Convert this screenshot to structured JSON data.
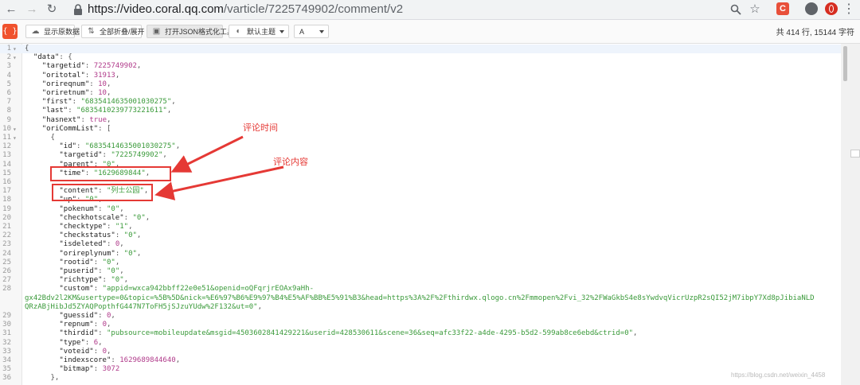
{
  "browser": {
    "url_host": "https://video.coral.qq.com",
    "url_path": "/varticle/7225749902/comment/v2",
    "ext_badge": "C"
  },
  "toolbar": {
    "logo": "{ }",
    "buttons": [
      {
        "label": "显示原数据"
      },
      {
        "label": "全部折叠/展开"
      },
      {
        "label": "打开JSON格式化工具"
      },
      {
        "label": "默认主题"
      },
      {
        "label": "A"
      }
    ],
    "stats": "共 414 行,  15144 字符"
  },
  "code_lines": [
    {
      "n": "1",
      "f": "▾",
      "t": [
        [
          "p",
          "{"
        ]
      ]
    },
    {
      "n": "2",
      "f": "▾",
      "t": [
        [
          "p",
          "  "
        ],
        [
          "k",
          "\"data\""
        ],
        [
          "p",
          ": {"
        ]
      ]
    },
    {
      "n": "3",
      "f": "",
      "t": [
        [
          "p",
          "    "
        ],
        [
          "k",
          "\"targetid\""
        ],
        [
          "p",
          ": "
        ],
        [
          "n",
          "7225749902"
        ],
        [
          "p",
          ","
        ]
      ]
    },
    {
      "n": "4",
      "f": "",
      "t": [
        [
          "p",
          "    "
        ],
        [
          "k",
          "\"oritotal\""
        ],
        [
          "p",
          ": "
        ],
        [
          "n",
          "31913"
        ],
        [
          "p",
          ","
        ]
      ]
    },
    {
      "n": "5",
      "f": "",
      "t": [
        [
          "p",
          "    "
        ],
        [
          "k",
          "\"orireqnum\""
        ],
        [
          "p",
          ": "
        ],
        [
          "n",
          "10"
        ],
        [
          "p",
          ","
        ]
      ]
    },
    {
      "n": "6",
      "f": "",
      "t": [
        [
          "p",
          "    "
        ],
        [
          "k",
          "\"oriretnum\""
        ],
        [
          "p",
          ": "
        ],
        [
          "n",
          "10"
        ],
        [
          "p",
          ","
        ]
      ]
    },
    {
      "n": "7",
      "f": "",
      "t": [
        [
          "p",
          "    "
        ],
        [
          "k",
          "\"first\""
        ],
        [
          "p",
          ": "
        ],
        [
          "s",
          "\"6835414635001030275\""
        ],
        [
          "p",
          ","
        ]
      ]
    },
    {
      "n": "8",
      "f": "",
      "t": [
        [
          "p",
          "    "
        ],
        [
          "k",
          "\"last\""
        ],
        [
          "p",
          ": "
        ],
        [
          "s",
          "\"6835410239773221611\""
        ],
        [
          "p",
          ","
        ]
      ]
    },
    {
      "n": "9",
      "f": "",
      "t": [
        [
          "p",
          "    "
        ],
        [
          "k",
          "\"hasnext\""
        ],
        [
          "p",
          ": "
        ],
        [
          "n",
          "true"
        ],
        [
          "p",
          ","
        ]
      ]
    },
    {
      "n": "10",
      "f": "▾",
      "t": [
        [
          "p",
          "    "
        ],
        [
          "k",
          "\"oriCommList\""
        ],
        [
          "p",
          ": ["
        ]
      ]
    },
    {
      "n": "11",
      "f": "▾",
      "t": [
        [
          "p",
          "      {"
        ]
      ]
    },
    {
      "n": "12",
      "f": "",
      "t": [
        [
          "p",
          "        "
        ],
        [
          "k",
          "\"id\""
        ],
        [
          "p",
          ": "
        ],
        [
          "s",
          "\"6835414635001030275\""
        ],
        [
          "p",
          ","
        ]
      ]
    },
    {
      "n": "13",
      "f": "",
      "t": [
        [
          "p",
          "        "
        ],
        [
          "k",
          "\"targetid\""
        ],
        [
          "p",
          ": "
        ],
        [
          "s",
          "\"7225749902\""
        ],
        [
          "p",
          ","
        ]
      ]
    },
    {
      "n": "14",
      "f": "",
      "t": [
        [
          "p",
          "        "
        ],
        [
          "k",
          "\"parent\""
        ],
        [
          "p",
          ": "
        ],
        [
          "s",
          "\"0\""
        ],
        [
          "p",
          ","
        ]
      ]
    },
    {
      "n": "15",
      "f": "",
      "t": [
        [
          "p",
          "        "
        ],
        [
          "k",
          "\"time\""
        ],
        [
          "p",
          ": "
        ],
        [
          "s",
          "\"1629689844\""
        ],
        [
          "p",
          ","
        ]
      ]
    },
    {
      "n": "16",
      "f": "",
      "t": [
        [
          "p",
          " "
        ]
      ]
    },
    {
      "n": "17",
      "f": "",
      "t": [
        [
          "p",
          "        "
        ],
        [
          "k",
          "\"content\""
        ],
        [
          "p",
          ": "
        ],
        [
          "s",
          "\"列士公园\""
        ],
        [
          "p",
          ","
        ]
      ]
    },
    {
      "n": "18",
      "f": "",
      "t": [
        [
          "p",
          "        "
        ],
        [
          "k",
          "\"up\""
        ],
        [
          "p",
          ": "
        ],
        [
          "s",
          "\"0\""
        ],
        [
          "p",
          ","
        ]
      ]
    },
    {
      "n": "19",
      "f": "",
      "t": [
        [
          "p",
          "        "
        ],
        [
          "k",
          "\"pokenum\""
        ],
        [
          "p",
          ": "
        ],
        [
          "s",
          "\"0\""
        ],
        [
          "p",
          ","
        ]
      ]
    },
    {
      "n": "20",
      "f": "",
      "t": [
        [
          "p",
          "        "
        ],
        [
          "k",
          "\"checkhotscale\""
        ],
        [
          "p",
          ": "
        ],
        [
          "s",
          "\"0\""
        ],
        [
          "p",
          ","
        ]
      ]
    },
    {
      "n": "21",
      "f": "",
      "t": [
        [
          "p",
          "        "
        ],
        [
          "k",
          "\"checktype\""
        ],
        [
          "p",
          ": "
        ],
        [
          "s",
          "\"1\""
        ],
        [
          "p",
          ","
        ]
      ]
    },
    {
      "n": "22",
      "f": "",
      "t": [
        [
          "p",
          "        "
        ],
        [
          "k",
          "\"checkstatus\""
        ],
        [
          "p",
          ": "
        ],
        [
          "s",
          "\"0\""
        ],
        [
          "p",
          ","
        ]
      ]
    },
    {
      "n": "23",
      "f": "",
      "t": [
        [
          "p",
          "        "
        ],
        [
          "k",
          "\"isdeleted\""
        ],
        [
          "p",
          ": "
        ],
        [
          "n",
          "0"
        ],
        [
          "p",
          ","
        ]
      ]
    },
    {
      "n": "24",
      "f": "",
      "t": [
        [
          "p",
          "        "
        ],
        [
          "k",
          "\"orireplynum\""
        ],
        [
          "p",
          ": "
        ],
        [
          "s",
          "\"0\""
        ],
        [
          "p",
          ","
        ]
      ]
    },
    {
      "n": "25",
      "f": "",
      "t": [
        [
          "p",
          "        "
        ],
        [
          "k",
          "\"rootid\""
        ],
        [
          "p",
          ": "
        ],
        [
          "s",
          "\"0\""
        ],
        [
          "p",
          ","
        ]
      ]
    },
    {
      "n": "26",
      "f": "",
      "t": [
        [
          "p",
          "        "
        ],
        [
          "k",
          "\"puserid\""
        ],
        [
          "p",
          ": "
        ],
        [
          "s",
          "\"0\""
        ],
        [
          "p",
          ","
        ]
      ]
    },
    {
      "n": "27",
      "f": "",
      "t": [
        [
          "p",
          "        "
        ],
        [
          "k",
          "\"richtype\""
        ],
        [
          "p",
          ": "
        ],
        [
          "s",
          "\"0\""
        ],
        [
          "p",
          ","
        ]
      ]
    },
    {
      "n": "28",
      "f": "",
      "t": [
        [
          "p",
          "        "
        ],
        [
          "k",
          "\"custom\""
        ],
        [
          "p",
          ": "
        ],
        [
          "s",
          "\"appid=wxca942bbff22e0e51&openid=oQFqrjrEOAx9aHh-"
        ]
      ]
    },
    {
      "n": "",
      "f": "",
      "t": [
        [
          "s",
          "gx42Bdv2l2KM&usertype=0&topic=%5B%5D&nick=%E6%97%B6%E9%97%B4%E5%AF%BB%E5%91%B3&head=https%3A%2F%2Fthirdwx.qlogo.cn%2Fmmopen%2Fvi_32%2FWaGkbS4e8sYwdvqVicrUzpR2sQI52jM7ibpY7Xd8pJibiaNLD"
        ]
      ]
    },
    {
      "n": "",
      "f": "",
      "t": [
        [
          "s",
          "QRzABjHibJd5ZYAQPopthfG447N7ToFH5jSJzuYUdw%2F132&ut=0\""
        ],
        [
          "p",
          ","
        ]
      ]
    },
    {
      "n": "29",
      "f": "",
      "t": [
        [
          "p",
          "        "
        ],
        [
          "k",
          "\"guessid\""
        ],
        [
          "p",
          ": "
        ],
        [
          "n",
          "0"
        ],
        [
          "p",
          ","
        ]
      ]
    },
    {
      "n": "30",
      "f": "",
      "t": [
        [
          "p",
          "        "
        ],
        [
          "k",
          "\"repnum\""
        ],
        [
          "p",
          ": "
        ],
        [
          "n",
          "0"
        ],
        [
          "p",
          ","
        ]
      ]
    },
    {
      "n": "31",
      "f": "",
      "t": [
        [
          "p",
          "        "
        ],
        [
          "k",
          "\"thirdid\""
        ],
        [
          "p",
          ": "
        ],
        [
          "s",
          "\"pubsource=mobileupdate&msgid=4503602841429221&userid=428530611&scene=36&seq=afc33f22-a4de-4295-b5d2-599ab8ce6ebd&ctrid=0\""
        ],
        [
          "p",
          ","
        ]
      ]
    },
    {
      "n": "32",
      "f": "",
      "t": [
        [
          "p",
          "        "
        ],
        [
          "k",
          "\"type\""
        ],
        [
          "p",
          ": "
        ],
        [
          "n",
          "6"
        ],
        [
          "p",
          ","
        ]
      ]
    },
    {
      "n": "33",
      "f": "",
      "t": [
        [
          "p",
          "        "
        ],
        [
          "k",
          "\"voteid\""
        ],
        [
          "p",
          ": "
        ],
        [
          "n",
          "0"
        ],
        [
          "p",
          ","
        ]
      ]
    },
    {
      "n": "34",
      "f": "",
      "t": [
        [
          "p",
          "        "
        ],
        [
          "k",
          "\"indexscore\""
        ],
        [
          "p",
          ": "
        ],
        [
          "n",
          "1629689844640"
        ],
        [
          "p",
          ","
        ]
      ]
    },
    {
      "n": "35",
      "f": "",
      "t": [
        [
          "p",
          "        "
        ],
        [
          "k",
          "\"bitmap\""
        ],
        [
          "p",
          ": "
        ],
        [
          "n",
          "3072"
        ]
      ]
    },
    {
      "n": "36",
      "f": "",
      "t": [
        [
          "p",
          "      },"
        ]
      ]
    }
  ],
  "annotations": {
    "time_label": "评论时间",
    "content_label": "评论内容",
    "color": "#e53935"
  },
  "watermark": "https://blog.csdn.net/weixin_4458"
}
